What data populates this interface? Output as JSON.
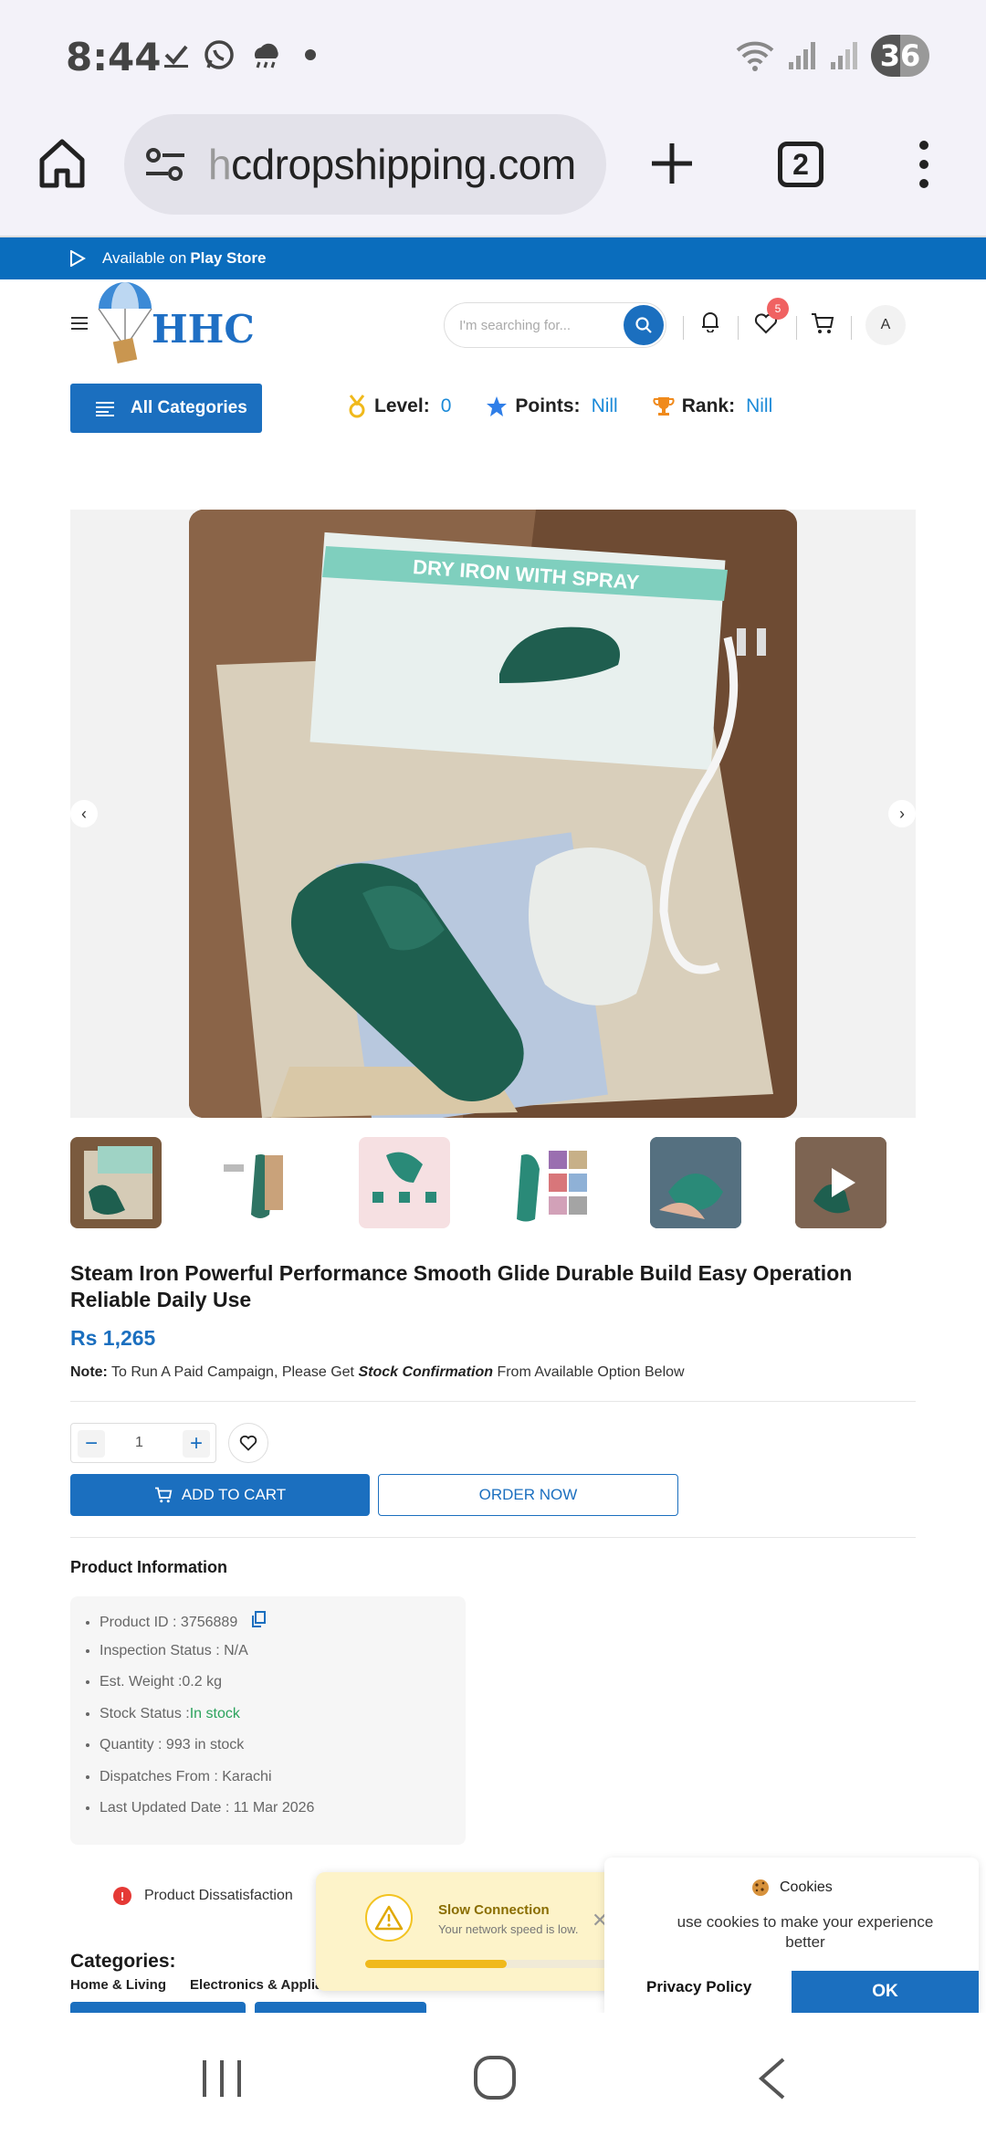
{
  "status_bar": {
    "time": "8:44",
    "battery": "36"
  },
  "browser": {
    "url_dim": "h",
    "url_main": "cdropshipping.com",
    "tab_count": "2"
  },
  "play_banner": {
    "prefix": "Available on",
    "store": "Play Store"
  },
  "header": {
    "logo_text": "HHC",
    "search_placeholder": "I'm searching for...",
    "wishlist_count": "5",
    "avatar_letter": "A"
  },
  "category_bar": {
    "all_categories_label": "All Categories",
    "level_label": "Level:",
    "level_value": "0",
    "points_label": "Points:",
    "points_value": "Nill",
    "rank_label": "Rank:",
    "rank_value": "Nill"
  },
  "gallery": {
    "box_text": "DRY IRON WITH SPRAY",
    "prev": "‹",
    "next": "›"
  },
  "product": {
    "title": "Steam Iron Powerful Performance Smooth Glide Durable Build Easy Operation Reliable Daily Use",
    "price": "Rs 1,265",
    "note_label": "Note:",
    "note_text_1": " To Run A Paid Campaign, Please Get ",
    "note_emph": "Stock Confirmation",
    "note_text_2": " From Available Option Below",
    "quantity": "1",
    "add_to_cart": "ADD TO CART",
    "order_now": "ORDER NOW"
  },
  "product_info": {
    "heading": "Product Information",
    "product_id": "Product ID : 3756889",
    "inspection": "Inspection Status : N/A",
    "weight": "Est. Weight :0.2 kg",
    "stock_label": "Stock Status :",
    "stock_value": "In stock",
    "quantity": "Quantity : 993 in stock",
    "dispatch": "Dispatches From : Karachi",
    "updated": "Last Updated Date : 11 Mar 2026"
  },
  "bottom": {
    "dissatisfaction": "Product Dissatisfaction",
    "categories_heading": "Categories:",
    "category_1": "Home & Living",
    "category_2": "Electronics & Applia"
  },
  "toast": {
    "title": "Slow Connection",
    "subtitle": "Your network speed is low.",
    "progress": 0.55
  },
  "cookies": {
    "title": "Cookies",
    "text": "use cookies to make your experience better",
    "privacy": "Privacy Policy",
    "ok": "OK"
  },
  "colors": {
    "primary": "#1b6fbf",
    "banner": "#0a6dbd",
    "success": "#2ca35d",
    "warning": "#f0b91b"
  }
}
